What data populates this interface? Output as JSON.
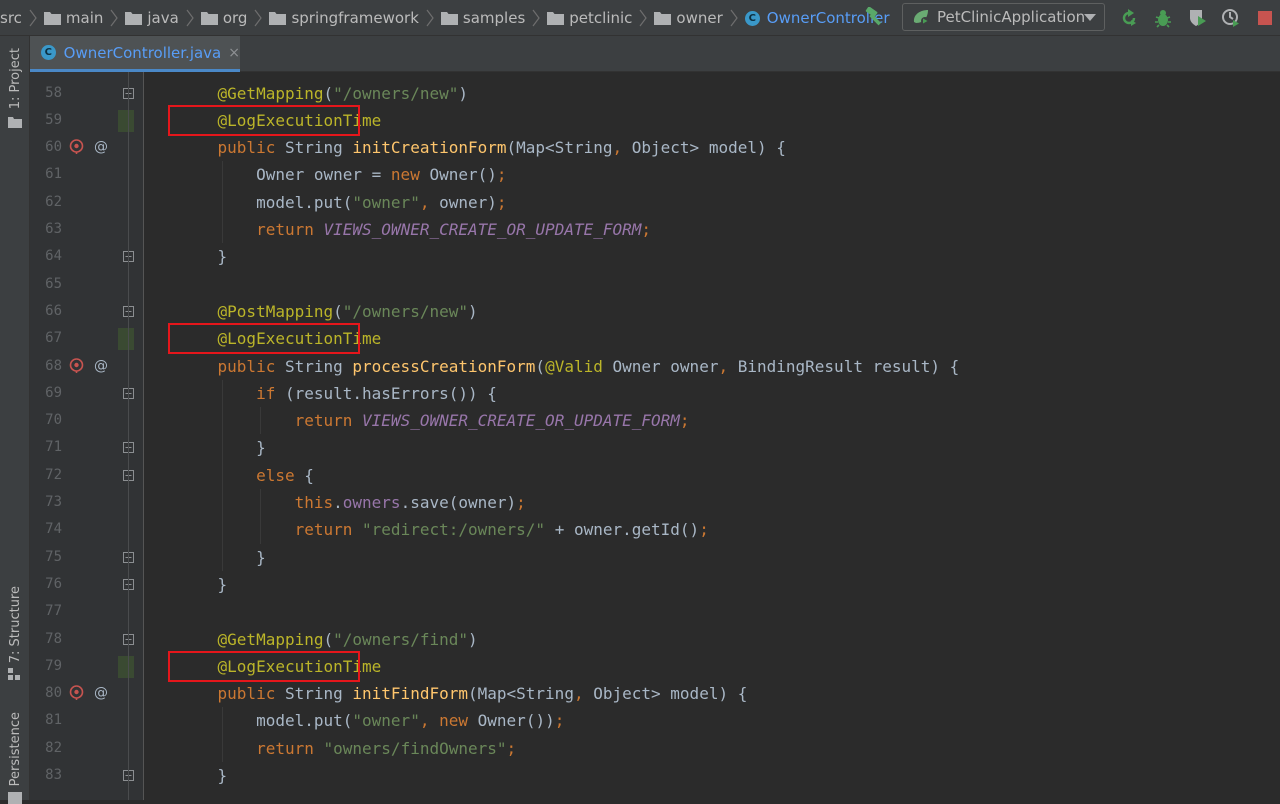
{
  "breadcrumbs": [
    "src",
    "main",
    "java",
    "org",
    "springframework",
    "samples",
    "petclinic",
    "owner",
    "OwnerController"
  ],
  "run_config": "PetClinicApplication",
  "tab": {
    "label": "OwnerController.java",
    "close": "×"
  },
  "toolstrip": {
    "project": "1: Project",
    "structure": "7: Structure",
    "persistence": "Persistence"
  },
  "code": {
    "first_line": 58,
    "highlighted_lines": [
      59,
      67,
      79
    ],
    "lines": [
      [
        {
          "t": "    "
        },
        {
          "t": "@GetMapping",
          "c": "annot"
        },
        {
          "t": "("
        },
        {
          "t": "\"/owners/new\"",
          "c": "str"
        },
        {
          "t": ")"
        }
      ],
      [
        {
          "t": "    "
        },
        {
          "t": "@LogExecutionTime",
          "c": "annot"
        }
      ],
      [
        {
          "t": "    "
        },
        {
          "t": "public",
          "c": "kw"
        },
        {
          "t": " String "
        },
        {
          "t": "initCreationForm",
          "c": "fn"
        },
        {
          "t": "(Map<String"
        },
        {
          "t": ",",
          "c": "kw"
        },
        {
          "t": " Object> model) {"
        }
      ],
      [
        {
          "t": "        Owner owner = "
        },
        {
          "t": "new",
          "c": "kw"
        },
        {
          "t": " Owner()"
        },
        {
          "t": ";",
          "c": "kw"
        }
      ],
      [
        {
          "t": "        model.put("
        },
        {
          "t": "\"owner\"",
          "c": "str"
        },
        {
          "t": ",",
          "c": "kw"
        },
        {
          "t": " owner)"
        },
        {
          "t": ";",
          "c": "kw"
        }
      ],
      [
        {
          "t": "        "
        },
        {
          "t": "return",
          "c": "kw"
        },
        {
          "t": " "
        },
        {
          "t": "VIEWS_OWNER_CREATE_OR_UPDATE_FORM",
          "c": "const"
        },
        {
          "t": ";",
          "c": "kw"
        }
      ],
      [
        {
          "t": "    }"
        }
      ],
      [],
      [
        {
          "t": "    "
        },
        {
          "t": "@PostMapping",
          "c": "annot"
        },
        {
          "t": "("
        },
        {
          "t": "\"/owners/new\"",
          "c": "str"
        },
        {
          "t": ")"
        }
      ],
      [
        {
          "t": "    "
        },
        {
          "t": "@LogExecutionTime",
          "c": "annot"
        }
      ],
      [
        {
          "t": "    "
        },
        {
          "t": "public",
          "c": "kw"
        },
        {
          "t": " String "
        },
        {
          "t": "processCreationForm",
          "c": "fn"
        },
        {
          "t": "("
        },
        {
          "t": "@Valid",
          "c": "annot"
        },
        {
          "t": " Owner owner"
        },
        {
          "t": ",",
          "c": "kw"
        },
        {
          "t": " BindingResult result) {"
        }
      ],
      [
        {
          "t": "        "
        },
        {
          "t": "if",
          "c": "kw"
        },
        {
          "t": " (result.hasErrors()) {"
        }
      ],
      [
        {
          "t": "            "
        },
        {
          "t": "return",
          "c": "kw"
        },
        {
          "t": " "
        },
        {
          "t": "VIEWS_OWNER_CREATE_OR_UPDATE_FORM",
          "c": "const"
        },
        {
          "t": ";",
          "c": "kw"
        }
      ],
      [
        {
          "t": "        }"
        }
      ],
      [
        {
          "t": "        "
        },
        {
          "t": "else",
          "c": "kw"
        },
        {
          "t": " {"
        }
      ],
      [
        {
          "t": "            "
        },
        {
          "t": "this",
          "c": "kw"
        },
        {
          "t": "."
        },
        {
          "t": "owners",
          "c": "field"
        },
        {
          "t": ".save(owner)"
        },
        {
          "t": ";",
          "c": "kw"
        }
      ],
      [
        {
          "t": "            "
        },
        {
          "t": "return",
          "c": "kw"
        },
        {
          "t": " "
        },
        {
          "t": "\"redirect:/owners/\"",
          "c": "str"
        },
        {
          "t": " + owner.getId()"
        },
        {
          "t": ";",
          "c": "kw"
        }
      ],
      [
        {
          "t": "        }"
        }
      ],
      [
        {
          "t": "    }"
        }
      ],
      [],
      [
        {
          "t": "    "
        },
        {
          "t": "@GetMapping",
          "c": "annot"
        },
        {
          "t": "("
        },
        {
          "t": "\"/owners/find\"",
          "c": "str"
        },
        {
          "t": ")"
        }
      ],
      [
        {
          "t": "    "
        },
        {
          "t": "@LogExecutionTime",
          "c": "annot"
        }
      ],
      [
        {
          "t": "    "
        },
        {
          "t": "public",
          "c": "kw"
        },
        {
          "t": " String "
        },
        {
          "t": "initFindForm",
          "c": "fn"
        },
        {
          "t": "(Map<String"
        },
        {
          "t": ",",
          "c": "kw"
        },
        {
          "t": " Object> model) {"
        }
      ],
      [
        {
          "t": "        model.put("
        },
        {
          "t": "\"owner\"",
          "c": "str"
        },
        {
          "t": ",",
          "c": "kw"
        },
        {
          "t": " "
        },
        {
          "t": "new",
          "c": "kw"
        },
        {
          "t": " Owner())"
        },
        {
          "t": ";",
          "c": "kw"
        }
      ],
      [
        {
          "t": "        "
        },
        {
          "t": "return",
          "c": "kw"
        },
        {
          "t": " "
        },
        {
          "t": "\"owners/findOwners\"",
          "c": "str"
        },
        {
          "t": ";",
          "c": "kw"
        }
      ],
      [
        {
          "t": "    }"
        }
      ]
    ]
  }
}
